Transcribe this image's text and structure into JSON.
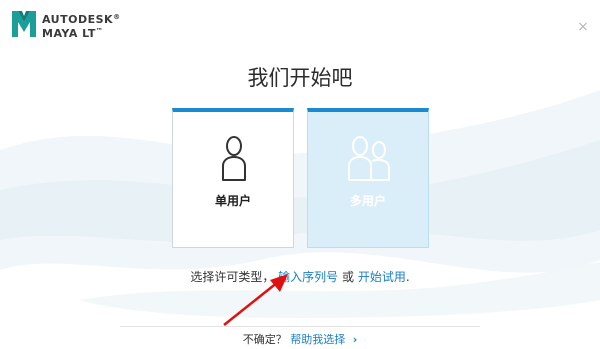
{
  "brand": {
    "company": "AUTODESK",
    "product": "MAYA LT",
    "trademark": "®",
    "product_trademark": "™",
    "accent": "#1a8ad1"
  },
  "window": {
    "close_icon": "close-icon"
  },
  "main": {
    "title": "我们开始吧",
    "cards": [
      {
        "label": "单用户",
        "icon": "single-user-icon",
        "selected": true
      },
      {
        "label": "多用户",
        "icon": "multi-user-icon",
        "selected": false
      }
    ],
    "prompt": {
      "prefix": "选择许可类型，",
      "link_serial": "输入序列号",
      "middle": "或",
      "link_trial": "开始试用",
      "suffix": "."
    }
  },
  "footer": {
    "question": "不确定？",
    "help_link": "帮助我选择",
    "chevron_icon": "chevron-right-icon"
  }
}
